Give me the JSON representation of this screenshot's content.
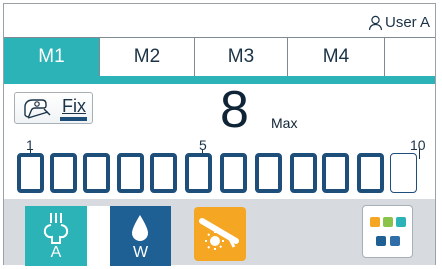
{
  "header": {
    "user_label": "User A"
  },
  "tabs": [
    {
      "label": "M1",
      "active": true
    },
    {
      "label": "M2",
      "active": false
    },
    {
      "label": "M3",
      "active": false
    },
    {
      "label": "M4",
      "active": false
    }
  ],
  "fix": {
    "label": "Fix"
  },
  "level": {
    "value": "8",
    "max_label": "Max",
    "filled": 8,
    "total": 10
  },
  "scale": {
    "tick_1": "1",
    "tick_5": "5",
    "tick_10": "10"
  },
  "spray": {
    "air_letter": "A",
    "water_letter": "W"
  },
  "colors": {
    "accent": "#2bb3b7",
    "navy": "#1e4f7a",
    "water": "#1e5f94",
    "light": "#f5a623",
    "panel": "#d7dade"
  },
  "icons": {
    "user": "user-icon",
    "fix": "handpiece-icon",
    "air": "air-spray-icon",
    "water": "water-drop-icon",
    "light": "handpiece-light-icon",
    "menu": "quick-menu-icon"
  }
}
